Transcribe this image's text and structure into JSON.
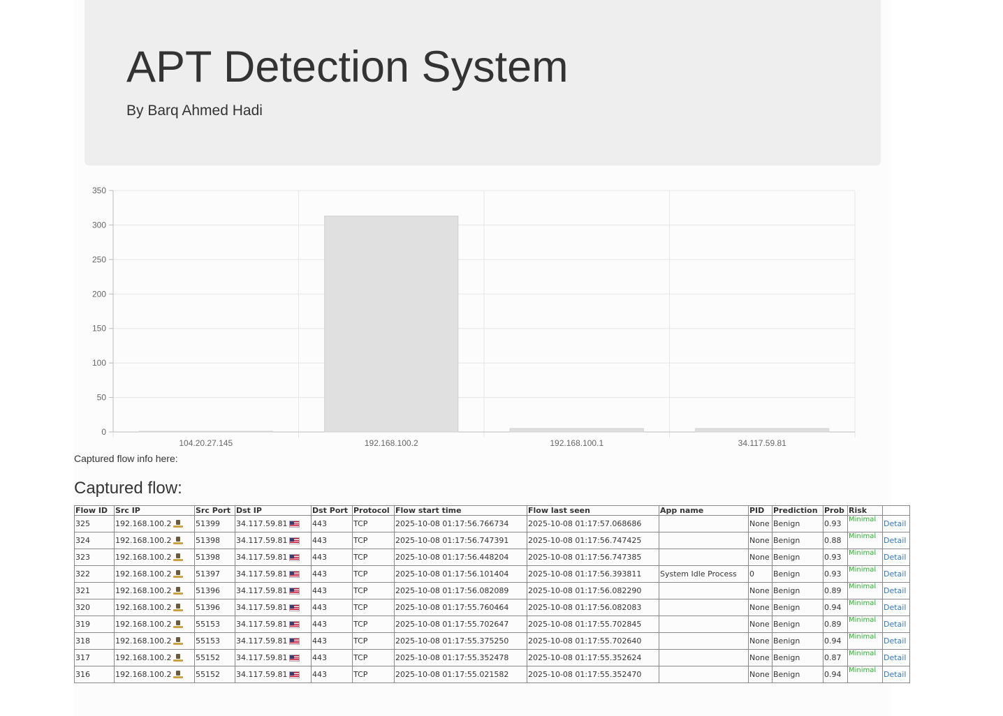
{
  "header": {
    "title": "APT Detection System",
    "subtitle": "By Barq Ahmed Hadi"
  },
  "chart_data": {
    "type": "bar",
    "categories": [
      "104.20.27.145",
      "192.168.100.2",
      "192.168.100.1",
      "34.117.59.81"
    ],
    "values": [
      1,
      313,
      5,
      5
    ],
    "ylim": [
      0,
      350
    ],
    "yticks": [
      0,
      50,
      100,
      150,
      200,
      250,
      300,
      350
    ],
    "grid": true,
    "colors": {
      "bar": "#e0e0e0",
      "bar_border": "#d0d0d0",
      "grid": "#e6e6e6",
      "axis": "#bbbbbb"
    }
  },
  "info_text": "Captured flow info here:",
  "flow_heading": "Captured flow:",
  "table": {
    "headers": [
      "Flow ID",
      "Src IP",
      "Src Port",
      "Dst IP",
      "Dst Port",
      "Protocol",
      "Flow start time",
      "Flow last seen",
      "App name",
      "PID",
      "Prediction",
      "Prob",
      "Risk",
      ""
    ],
    "detail_label": "Detail",
    "rows": [
      {
        "id": "325",
        "src_ip": "192.168.100.2",
        "src_port": "51399",
        "dst_ip": "34.117.59.81",
        "dst_port": "443",
        "protocol": "TCP",
        "start": "2025-10-08 01:17:56.766734",
        "last": "2025-10-08 01:17:57.068686",
        "app": "",
        "pid": "None",
        "prediction": "Benign",
        "prob": "0.93",
        "risk": "Minimal"
      },
      {
        "id": "324",
        "src_ip": "192.168.100.2",
        "src_port": "51398",
        "dst_ip": "34.117.59.81",
        "dst_port": "443",
        "protocol": "TCP",
        "start": "2025-10-08 01:17:56.747391",
        "last": "2025-10-08 01:17:56.747425",
        "app": "",
        "pid": "None",
        "prediction": "Benign",
        "prob": "0.88",
        "risk": "Minimal"
      },
      {
        "id": "323",
        "src_ip": "192.168.100.2",
        "src_port": "51398",
        "dst_ip": "34.117.59.81",
        "dst_port": "443",
        "protocol": "TCP",
        "start": "2025-10-08 01:17:56.448204",
        "last": "2025-10-08 01:17:56.747385",
        "app": "",
        "pid": "None",
        "prediction": "Benign",
        "prob": "0.93",
        "risk": "Minimal"
      },
      {
        "id": "322",
        "src_ip": "192.168.100.2",
        "src_port": "51397",
        "dst_ip": "34.117.59.81",
        "dst_port": "443",
        "protocol": "TCP",
        "start": "2025-10-08 01:17:56.101404",
        "last": "2025-10-08 01:17:56.393811",
        "app": "System Idle Process",
        "pid": "0",
        "prediction": "Benign",
        "prob": "0.93",
        "risk": "Minimal"
      },
      {
        "id": "321",
        "src_ip": "192.168.100.2",
        "src_port": "51396",
        "dst_ip": "34.117.59.81",
        "dst_port": "443",
        "protocol": "TCP",
        "start": "2025-10-08 01:17:56.082089",
        "last": "2025-10-08 01:17:56.082290",
        "app": "",
        "pid": "None",
        "prediction": "Benign",
        "prob": "0.89",
        "risk": "Minimal"
      },
      {
        "id": "320",
        "src_ip": "192.168.100.2",
        "src_port": "51396",
        "dst_ip": "34.117.59.81",
        "dst_port": "443",
        "protocol": "TCP",
        "start": "2025-10-08 01:17:55.760464",
        "last": "2025-10-08 01:17:56.082083",
        "app": "",
        "pid": "None",
        "prediction": "Benign",
        "prob": "0.94",
        "risk": "Minimal"
      },
      {
        "id": "319",
        "src_ip": "192.168.100.2",
        "src_port": "55153",
        "dst_ip": "34.117.59.81",
        "dst_port": "443",
        "protocol": "TCP",
        "start": "2025-10-08 01:17:55.702647",
        "last": "2025-10-08 01:17:55.702845",
        "app": "",
        "pid": "None",
        "prediction": "Benign",
        "prob": "0.89",
        "risk": "Minimal"
      },
      {
        "id": "318",
        "src_ip": "192.168.100.2",
        "src_port": "55153",
        "dst_ip": "34.117.59.81",
        "dst_port": "443",
        "protocol": "TCP",
        "start": "2025-10-08 01:17:55.375250",
        "last": "2025-10-08 01:17:55.702640",
        "app": "",
        "pid": "None",
        "prediction": "Benign",
        "prob": "0.94",
        "risk": "Minimal"
      },
      {
        "id": "317",
        "src_ip": "192.168.100.2",
        "src_port": "55152",
        "dst_ip": "34.117.59.81",
        "dst_port": "443",
        "protocol": "TCP",
        "start": "2025-10-08 01:17:55.352478",
        "last": "2025-10-08 01:17:55.352624",
        "app": "",
        "pid": "None",
        "prediction": "Benign",
        "prob": "0.87",
        "risk": "Minimal"
      },
      {
        "id": "316",
        "src_ip": "192.168.100.2",
        "src_port": "55152",
        "dst_ip": "34.117.59.81",
        "dst_port": "443",
        "protocol": "TCP",
        "start": "2025-10-08 01:17:55.021582",
        "last": "2025-10-08 01:17:55.352470",
        "app": "",
        "pid": "None",
        "prediction": "Benign",
        "prob": "0.94",
        "risk": "Minimal"
      }
    ]
  }
}
